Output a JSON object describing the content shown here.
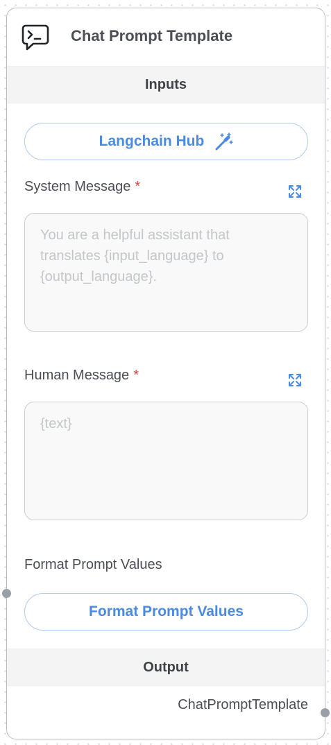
{
  "node": {
    "title": "Chat Prompt Template",
    "icon": "terminal-message-icon"
  },
  "inputs": {
    "section_label": "Inputs",
    "hub_button_label": "Langchain Hub",
    "system_message": {
      "label": "System Message",
      "required_mark": "*",
      "placeholder": "You are a helpful assistant that translates {input_language} to {output_language}."
    },
    "human_message": {
      "label": "Human Message",
      "required_mark": "*",
      "placeholder": "{text}"
    },
    "format_prompt_values": {
      "label": "Format Prompt Values",
      "button_label": "Format Prompt Values"
    }
  },
  "output": {
    "section_label": "Output",
    "value_label": "ChatPromptTemplate"
  },
  "colors": {
    "accent": "#4a8ae0",
    "required": "#d6453b",
    "handle": "#9aa0a6"
  }
}
